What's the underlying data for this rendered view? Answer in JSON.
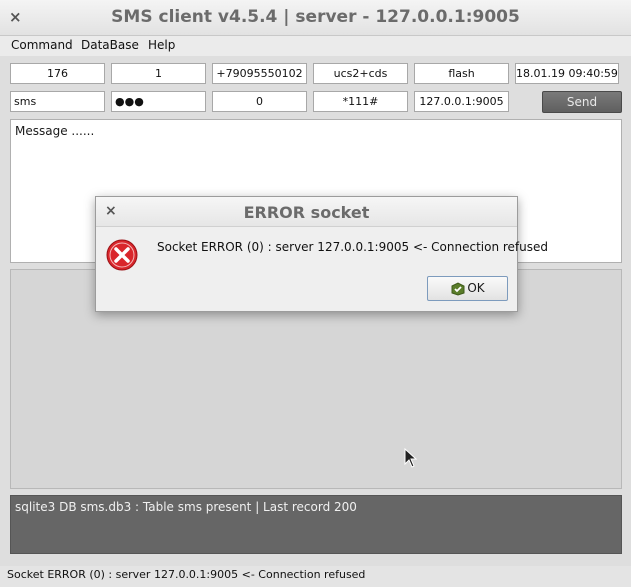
{
  "window": {
    "title": "SMS client v4.5.4 | server - 127.0.0.1:9005",
    "close_glyph": "×"
  },
  "menu": [
    "Command",
    "DataBase",
    "Help"
  ],
  "row1": [
    "176",
    "1",
    "+79095550102",
    "ucs2+cds",
    "flash",
    "18.01.19  09:40:59"
  ],
  "row2": [
    "sms",
    "●●●",
    "0",
    "*111#",
    "127.0.0.1:9005"
  ],
  "send_label": "Send",
  "message_text": "Message ......",
  "db_status": "sqlite3 DB sms.db3 : Table sms present | Last record 200",
  "status_bar": "Socket ERROR (0) : server 127.0.0.1:9005 <- Connection refused",
  "dialog": {
    "title": "ERROR socket",
    "close_glyph": "×",
    "message": "Socket ERROR (0) : server 127.0.0.1:9005 <- Connection refused",
    "ok_label": "OK",
    "icon": "error-icon",
    "error_color": "#d9262b"
  }
}
